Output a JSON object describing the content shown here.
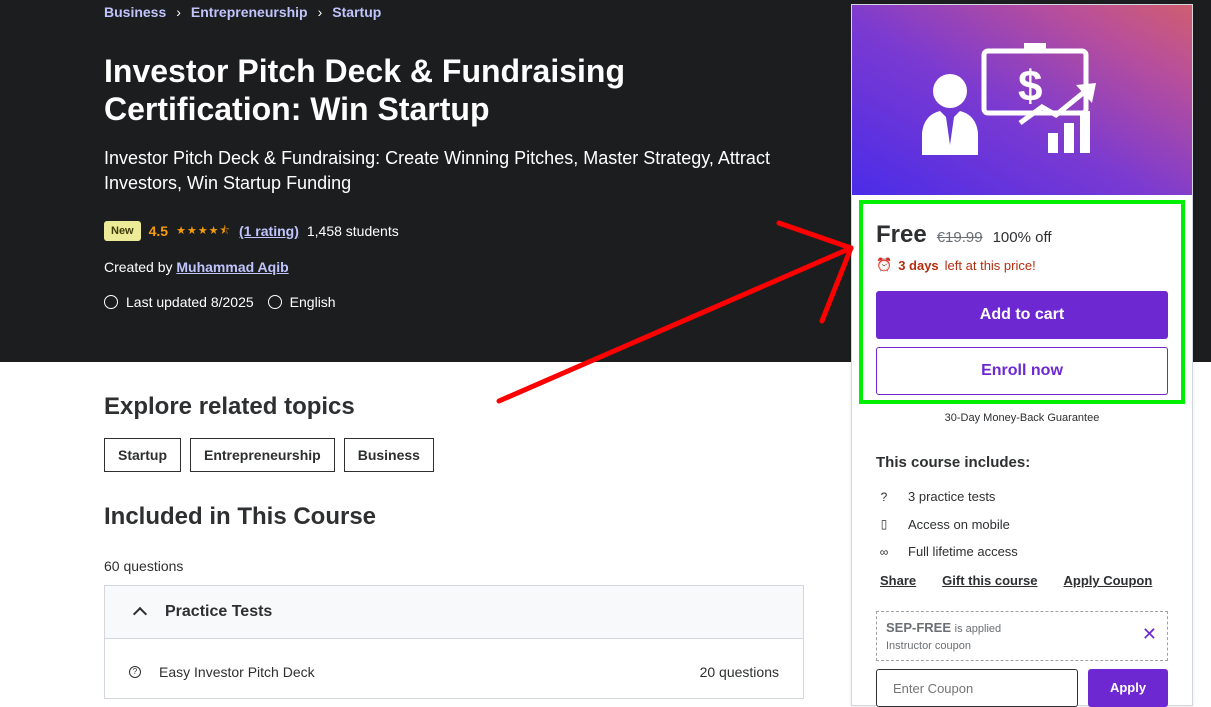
{
  "breadcrumbs": [
    "Business",
    "Entrepreneurship",
    "Startup"
  ],
  "course": {
    "title": "Investor Pitch Deck & Fundraising Certification: Win Startup",
    "subtitle": "Investor Pitch Deck & Fundraising: Create Winning Pitches, Master Strategy, Attract Investors, Win Startup Funding",
    "badge": "New",
    "rating": "4.5",
    "rating_count": "(1 rating)",
    "students": "1,458 students",
    "created_by_label": "Created by",
    "author": "Muhammad Aqib",
    "last_updated": "Last updated 8/2025",
    "language": "English"
  },
  "explore": {
    "title": "Explore related topics",
    "topics": [
      "Startup",
      "Entrepreneurship",
      "Business"
    ]
  },
  "included": {
    "title": "Included in This Course",
    "question_count": "60 questions",
    "section_label": "Practice Tests",
    "items": [
      {
        "name": "Easy Investor Pitch Deck",
        "count": "20 questions"
      }
    ]
  },
  "purchase": {
    "price": "Free",
    "original_price": "€19.99",
    "discount": "100% off",
    "timer_days": "3 days",
    "timer_rest": "left at this price!",
    "add_to_cart": "Add to cart",
    "enroll_now": "Enroll now",
    "guarantee": "30-Day Money-Back Guarantee",
    "includes_title": "This course includes:",
    "includes": [
      {
        "icon": "question-circle-icon",
        "glyph": "?",
        "label": "3 practice tests"
      },
      {
        "icon": "mobile-icon",
        "glyph": "▯",
        "label": "Access on mobile"
      },
      {
        "icon": "infinity-icon",
        "glyph": "∞",
        "label": "Full lifetime access"
      }
    ],
    "links": [
      "Share",
      "Gift this course",
      "Apply Coupon"
    ],
    "coupon": {
      "code": "SEP-FREE",
      "applied_text": "is applied",
      "sub": "Instructor coupon",
      "placeholder": "Enter Coupon",
      "apply_label": "Apply"
    }
  },
  "annotation_colors": {
    "arrow": "#ff0000",
    "highlight": "#00ee00"
  }
}
